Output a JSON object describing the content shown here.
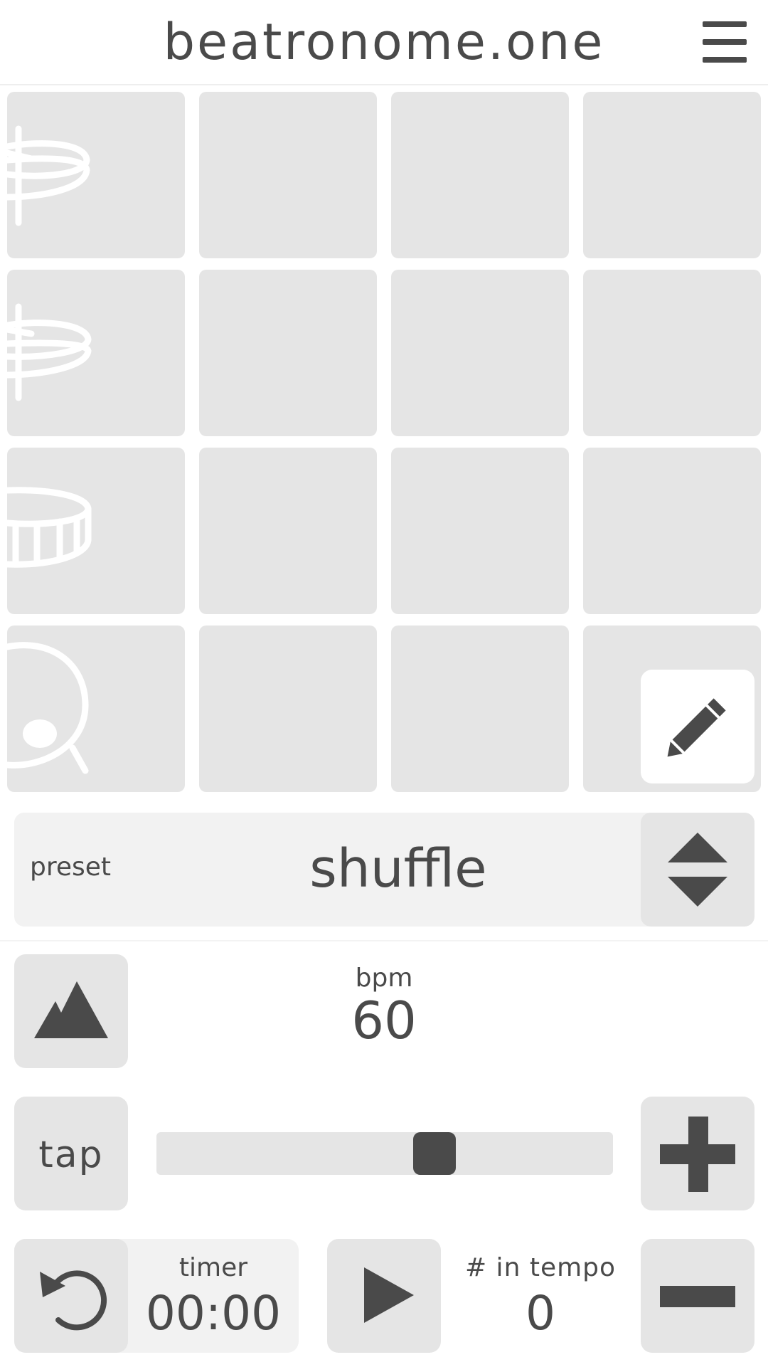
{
  "app": {
    "title": "beatronome.one"
  },
  "header": {
    "menu_icon": "hamburger-menu-icon"
  },
  "grid": {
    "rows": [
      {
        "instrument": "hi-hat",
        "icon": "hihat-icon",
        "steps": [
          false,
          false,
          false,
          false
        ]
      },
      {
        "instrument": "cymbal",
        "icon": "cymbal-icon",
        "steps": [
          false,
          false,
          false,
          false
        ]
      },
      {
        "instrument": "snare",
        "icon": "snare-drum-icon",
        "steps": [
          false,
          false,
          false,
          false
        ]
      },
      {
        "instrument": "kick",
        "icon": "kick-drum-icon",
        "steps": [
          false,
          false,
          false,
          false
        ]
      }
    ],
    "edit_icon": "pencil-icon"
  },
  "preset": {
    "label": "preset",
    "value": "shuffle",
    "toggle_icon": "chevron-up-down-icon"
  },
  "tempo": {
    "bpm_label": "bpm",
    "bpm_value": "60",
    "accent_icon": "mountain-icon",
    "tap_label": "tap",
    "slider_position": 0.62,
    "increment_icon": "plus-icon",
    "decrement_icon": "minus-icon"
  },
  "timer": {
    "label": "timer",
    "value": "00:00",
    "reset_icon": "reset-icon"
  },
  "playback": {
    "play_icon": "play-icon"
  },
  "in_tempo": {
    "label": "# in tempo",
    "value": "0"
  },
  "colors": {
    "pad": "#e5e5e5",
    "panel": "#f2f2f2",
    "ink": "#4a4a4a",
    "background": "#ffffff"
  }
}
